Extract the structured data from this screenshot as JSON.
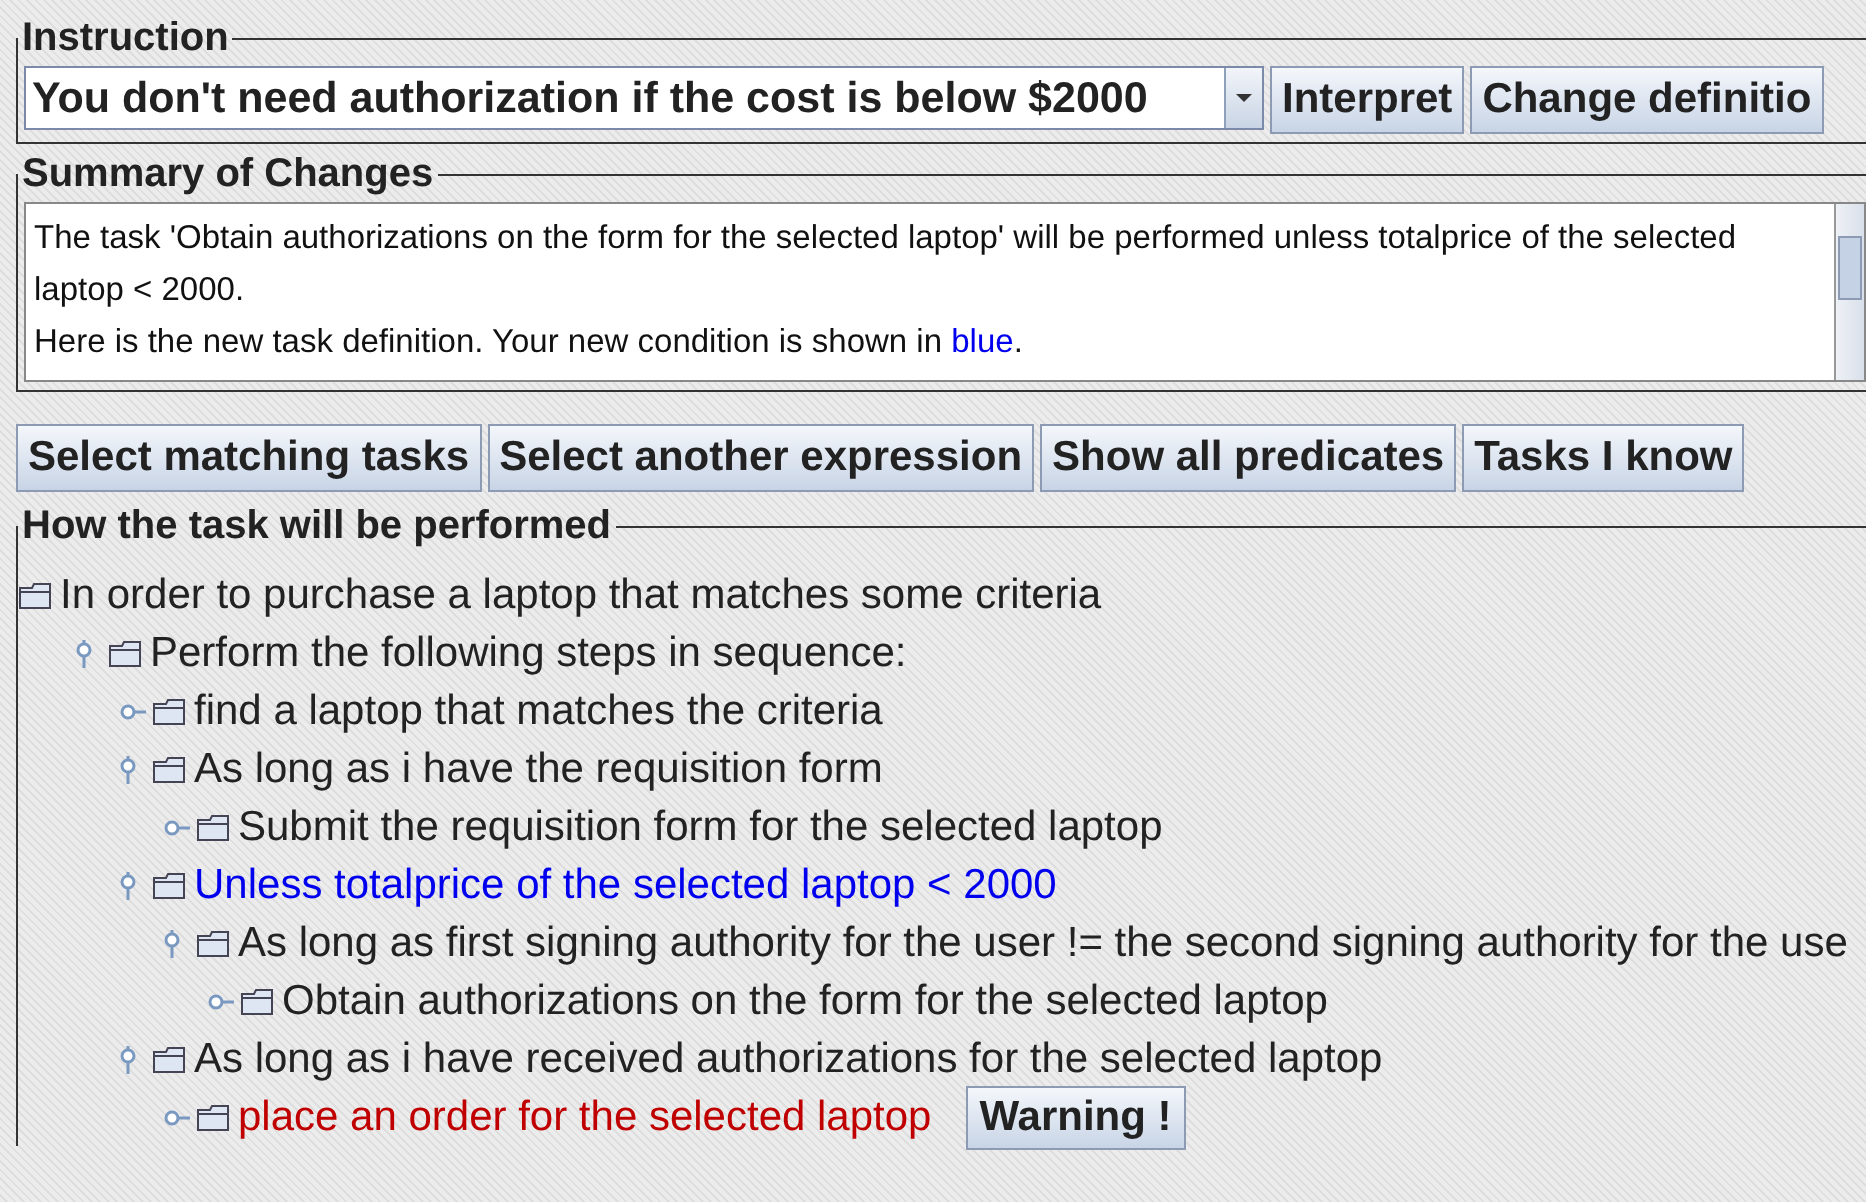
{
  "instruction": {
    "legend": "Instruction",
    "value": "You don't need authorization if the cost is below $2000",
    "buttons": [
      "Interpret",
      "Change definitio"
    ]
  },
  "summary": {
    "legend": "Summary of Changes",
    "paragraphs": [
      [
        {
          "kind": "plain",
          "text": "The task 'Obtain authorizations on the form for the selected laptop' will be performed unless totalprice of the selected laptop < 2000."
        }
      ],
      [
        {
          "kind": "plain",
          "text": "Here is the new task definition. Your new condition is shown in "
        },
        {
          "kind": "added",
          "text": "blue"
        },
        {
          "kind": "plain",
          "text": "."
        }
      ]
    ]
  },
  "toolbar": [
    "Select matching tasks",
    "Select another expression",
    "Show all predicates",
    "Tasks I know"
  ],
  "tree": {
    "legend": "How the task will be performed",
    "nodes": [
      {
        "text": "In order to purchase a laptop that matches some criteria",
        "kind": "plain",
        "children": [
          {
            "text": "Perform the following steps in sequence:",
            "kind": "plain",
            "expanded": true,
            "children": [
              {
                "text": "find a laptop that matches the criteria",
                "kind": "plain"
              },
              {
                "text": "As long as i have the requisition form",
                "kind": "plain",
                "expanded": true,
                "children": [
                  {
                    "text": "Submit the requisition form for the selected laptop",
                    "kind": "plain"
                  }
                ]
              },
              {
                "text": "Unless totalprice of the selected laptop < 2000",
                "kind": "added",
                "expanded": true,
                "children": [
                  {
                    "text": "As long as first signing authority for the user != the second signing authority for the use",
                    "kind": "plain",
                    "expanded": true,
                    "children": [
                      {
                        "text": "Obtain authorizations on the form for the selected laptop",
                        "kind": "plain"
                      }
                    ]
                  }
                ]
              },
              {
                "text": "As long as i have received authorizations for the selected laptop",
                "kind": "plain",
                "expanded": true,
                "children": [
                  {
                    "text": "place an order for the selected laptop",
                    "kind": "error",
                    "warning": "Warning !"
                  }
                ]
              }
            ]
          }
        ]
      }
    ]
  }
}
